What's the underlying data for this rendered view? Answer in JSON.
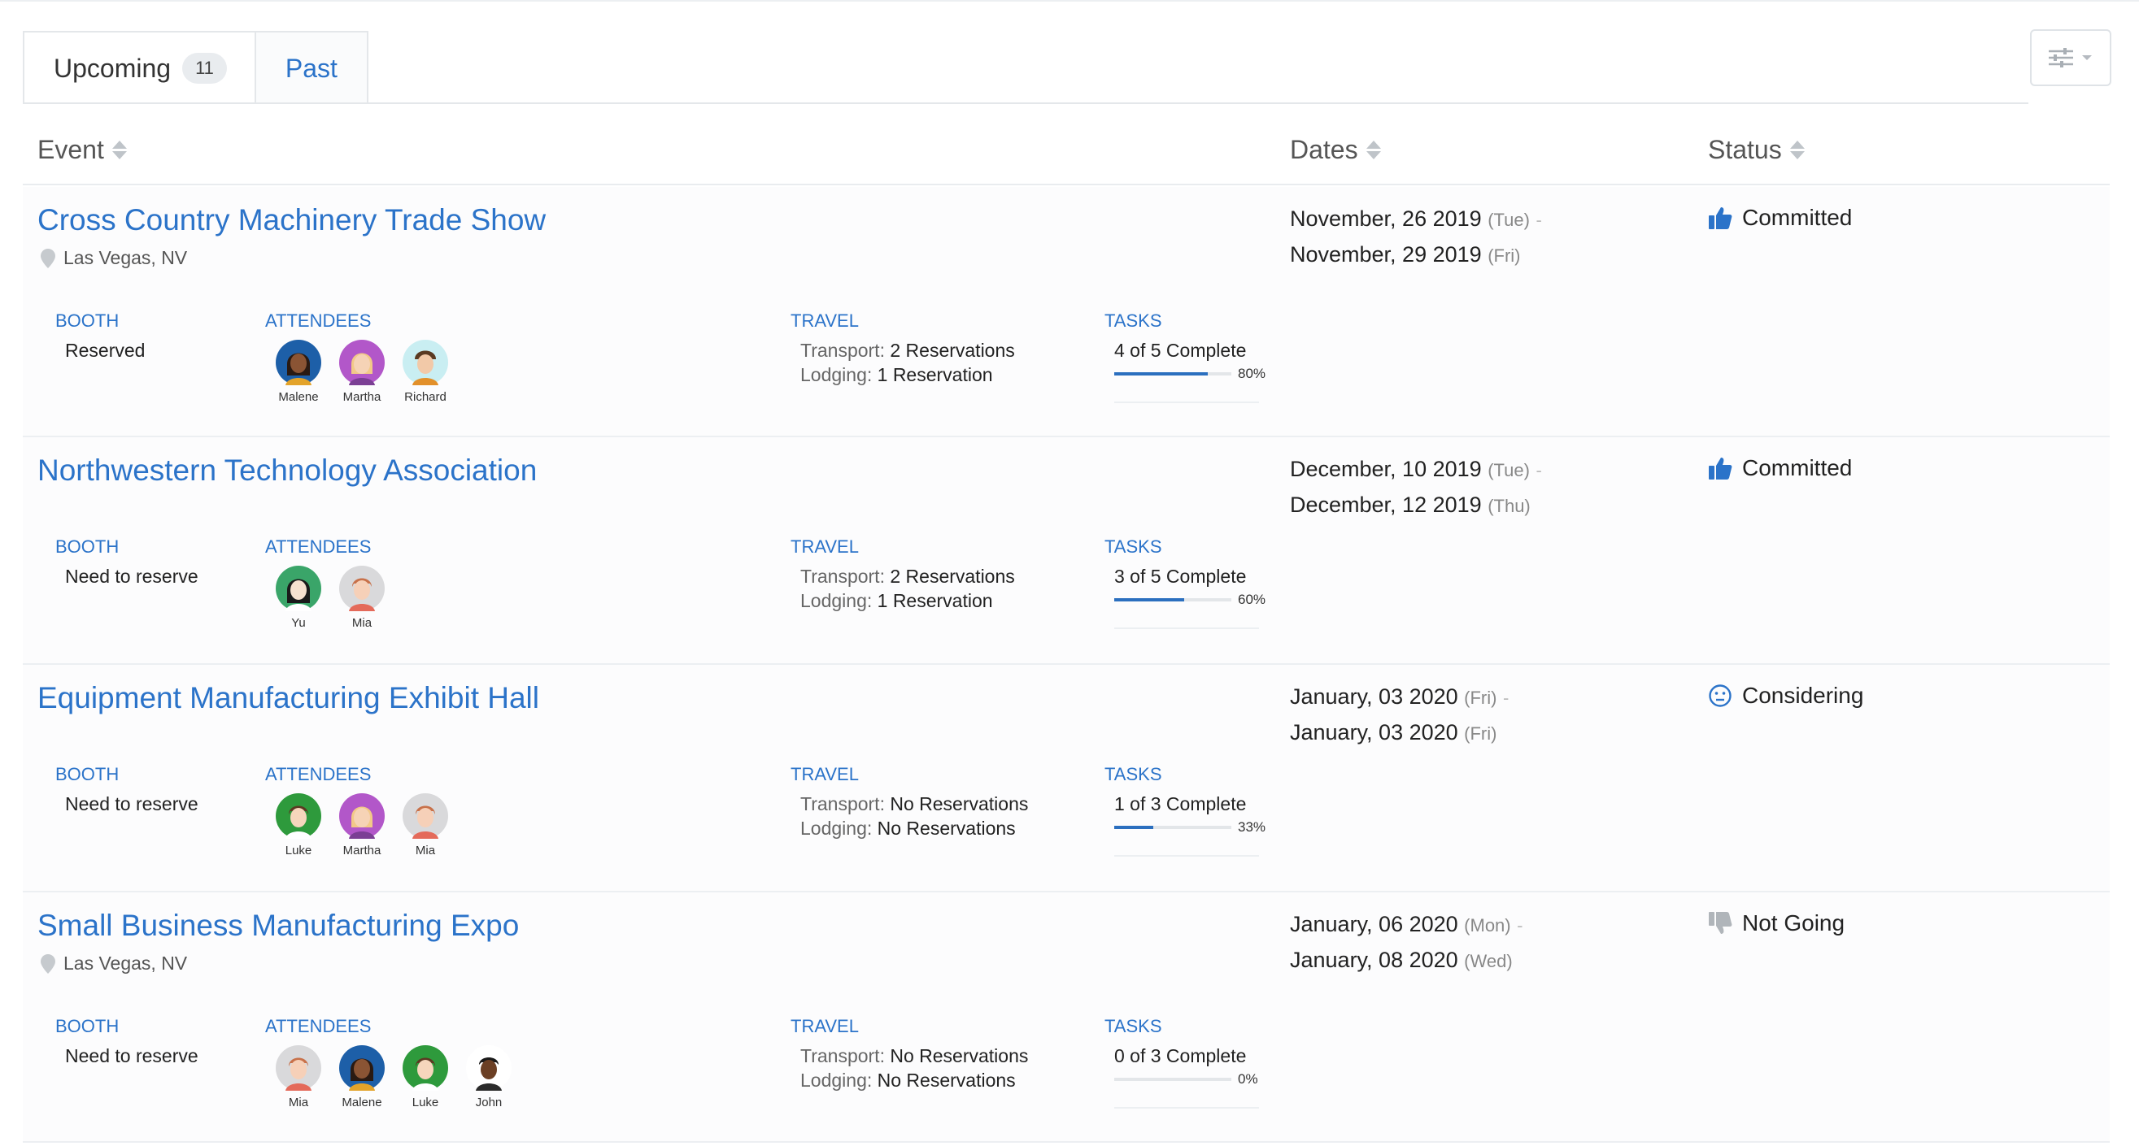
{
  "tabs": {
    "upcoming_label": "Upcoming",
    "upcoming_count": "11",
    "past_label": "Past"
  },
  "columns": {
    "event": "Event",
    "dates": "Dates",
    "status": "Status"
  },
  "labels": {
    "booth": "BOOTH",
    "attendees": "ATTENDEES",
    "travel": "TRAVEL",
    "tasks": "TASKS",
    "transport": "Transport:",
    "lodging": "Lodging:"
  },
  "colors": {
    "accent": "#2b73c9",
    "progress": "#2b6fbf",
    "not_going": "#b0b5ba"
  },
  "events": [
    {
      "title": "Cross Country Machinery Trade Show",
      "location": "Las Vegas, NV",
      "booth": "Reserved",
      "attendees": [
        "Malene",
        "Martha",
        "Richard"
      ],
      "transport": "2 Reservations",
      "lodging": "1 Reservation",
      "tasks": "4 of 5 Complete",
      "progress_pct": 80,
      "progress_label": "80%",
      "start": "November, 26 2019",
      "start_dow": "(Tue)",
      "end": "November, 29 2019",
      "end_dow": "(Fri)",
      "status": "Committed",
      "status_icon": "thumbs-up-icon"
    },
    {
      "title": "Northwestern Technology Association",
      "location": "",
      "booth": "Need to reserve",
      "attendees": [
        "Yu",
        "Mia"
      ],
      "transport": "2 Reservations",
      "lodging": "1 Reservation",
      "tasks": "3 of 5 Complete",
      "progress_pct": 60,
      "progress_label": "60%",
      "start": "December, 10 2019",
      "start_dow": "(Tue)",
      "end": "December, 12 2019",
      "end_dow": "(Thu)",
      "status": "Committed",
      "status_icon": "thumbs-up-icon"
    },
    {
      "title": "Equipment Manufacturing Exhibit Hall",
      "location": "",
      "booth": "Need to reserve",
      "attendees": [
        "Luke",
        "Martha",
        "Mia"
      ],
      "transport": "No Reservations",
      "lodging": "No Reservations",
      "tasks": "1 of 3 Complete",
      "progress_pct": 33,
      "progress_label": "33%",
      "start": "January, 03 2020",
      "start_dow": "(Fri)",
      "end": "January, 03 2020",
      "end_dow": "(Fri)",
      "status": "Considering",
      "status_icon": "neutral-face-icon"
    },
    {
      "title": "Small Business Manufacturing Expo",
      "location": "Las Vegas, NV",
      "booth": "Need to reserve",
      "attendees": [
        "Mia",
        "Malene",
        "Luke",
        "John"
      ],
      "transport": "No Reservations",
      "lodging": "No Reservations",
      "tasks": "0 of 3 Complete",
      "progress_pct": 0,
      "progress_label": "0%",
      "start": "January, 06 2020",
      "start_dow": "(Mon)",
      "end": "January, 08 2020",
      "end_dow": "(Wed)",
      "status": "Not Going",
      "status_icon": "thumbs-down-icon"
    }
  ]
}
